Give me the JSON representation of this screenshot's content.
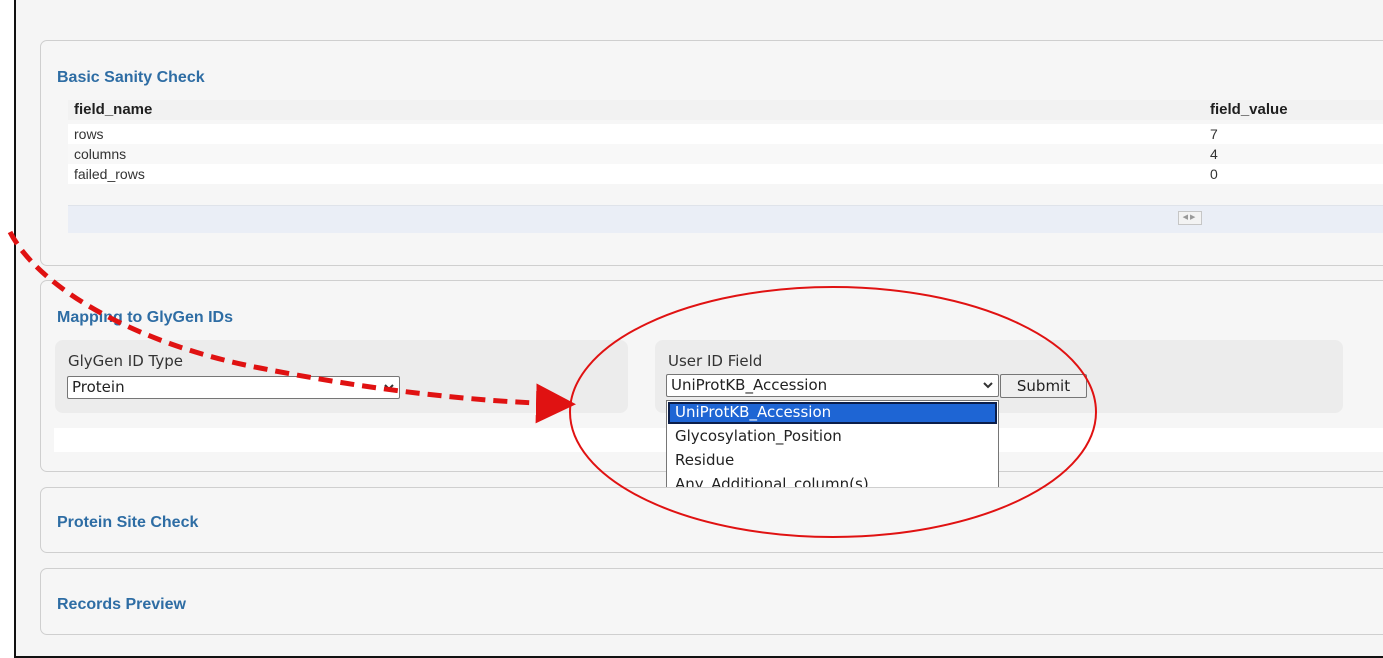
{
  "sanity": {
    "title": "Basic Sanity Check",
    "columns": [
      "field_name",
      "field_value"
    ],
    "rows": [
      {
        "name": "rows",
        "value": "7"
      },
      {
        "name": "columns",
        "value": "4"
      },
      {
        "name": "failed_rows",
        "value": "0"
      }
    ],
    "scroll_arrows": "◀▶"
  },
  "mapping": {
    "title": "Mapping to GlyGen IDs",
    "glygen_label": "GlyGen ID Type",
    "glygen_value": "Protein",
    "user_label": "User ID Field",
    "user_value": "UniProtKB_Accession",
    "submit_label": "Submit",
    "options": [
      "UniProtKB_Accession",
      "Glycosylation_Position",
      "Residue",
      "Any_Additional_column(s)"
    ]
  },
  "protein_site": {
    "title": "Protein Site Check"
  },
  "records_preview": {
    "title": "Records Preview"
  },
  "icons": {
    "dropdown": "chevron-down-icon"
  },
  "colors": {
    "accent": "#2e6da4",
    "annotation": "#e01212",
    "selected": "#1e65d4"
  }
}
